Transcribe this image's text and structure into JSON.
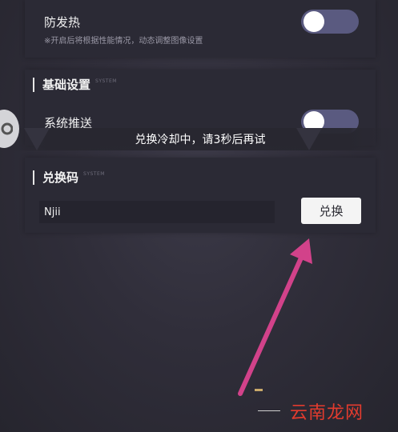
{
  "top_card": {
    "title": "防发热",
    "description": "※开启后将根据性能情况，动态调整图像设置",
    "toggle_on": false
  },
  "basic_settings": {
    "section_title": "基础设置",
    "section_sub": "SYSTEM",
    "push_label": "系统推送",
    "push_toggle_on": false
  },
  "toast": {
    "message": "兑换冷却中，请3秒后再试"
  },
  "redeem": {
    "section_title": "兑换码",
    "section_sub": "SYSTEM",
    "input_value": "Njii",
    "button_label": "兑换"
  },
  "annotation": {
    "arrow_color": "#d2428a"
  },
  "watermark": {
    "text": "云南龙网"
  }
}
